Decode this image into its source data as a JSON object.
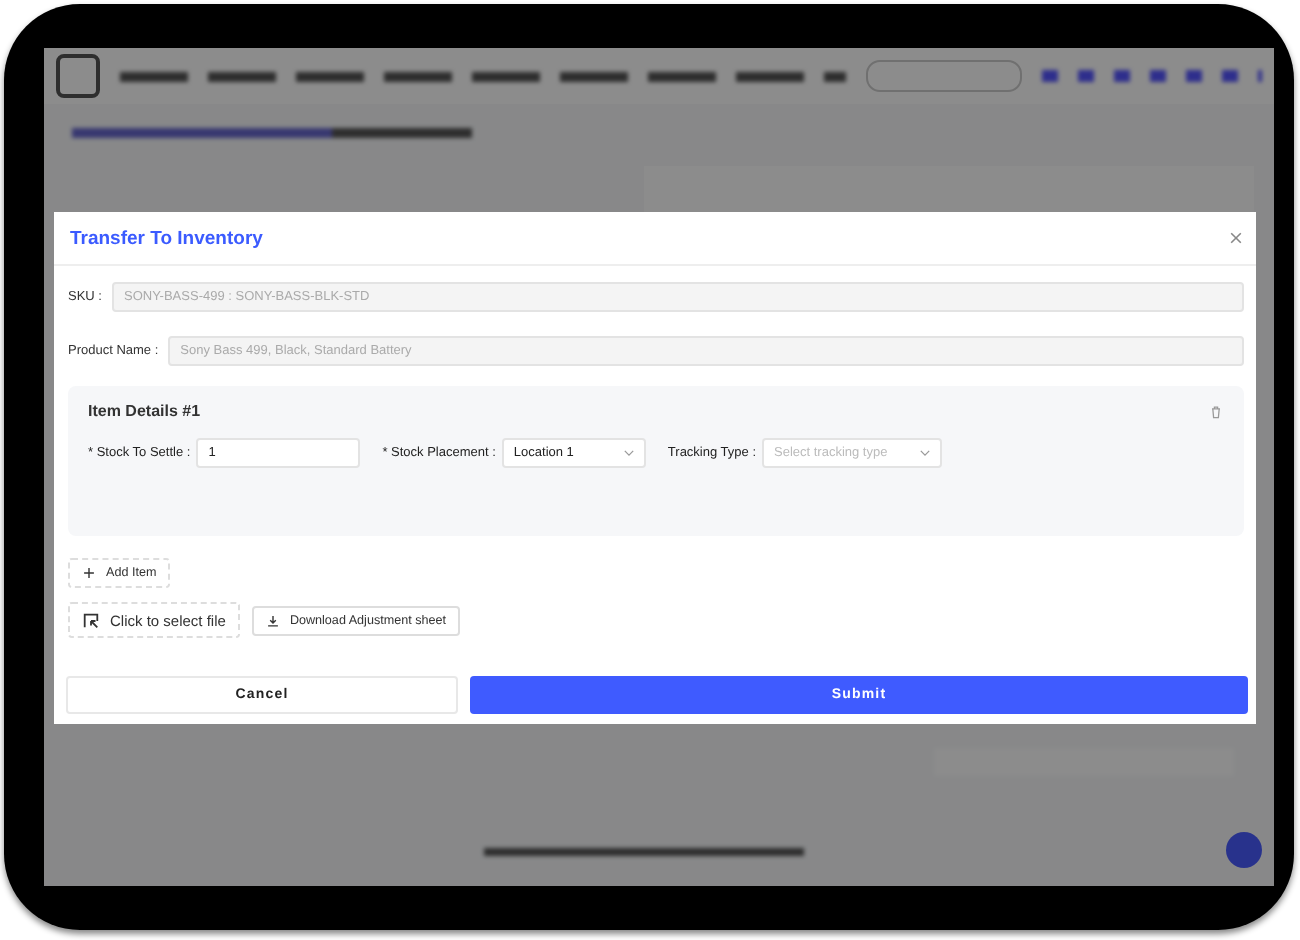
{
  "modal": {
    "title": "Transfer To Inventory",
    "fields": [
      {
        "label": "SKU :",
        "value": "SONY-BASS-499 : SONY-BASS-BLK-STD",
        "disabled": true
      },
      {
        "label": "Product Name :",
        "value": "Sony Bass 499, Black, Standard Battery",
        "disabled": true
      }
    ],
    "items": [
      {
        "title": "Item Details #1",
        "fields": [
          {
            "kind": "input",
            "label": "* Stock To Settle :",
            "value": "1"
          },
          {
            "kind": "select",
            "label": "* Stock Placement :",
            "value": "Location 1"
          },
          {
            "kind": "select",
            "label": "Tracking Type :",
            "placeholder": "Select tracking type"
          }
        ]
      }
    ],
    "add_item": "Add Item",
    "upload": "Click to select file",
    "download": "Download Adjustment sheet",
    "buttons": [
      {
        "label": "Cancel",
        "kind": "secondary"
      },
      {
        "label": "Submit",
        "kind": "primary"
      }
    ]
  }
}
